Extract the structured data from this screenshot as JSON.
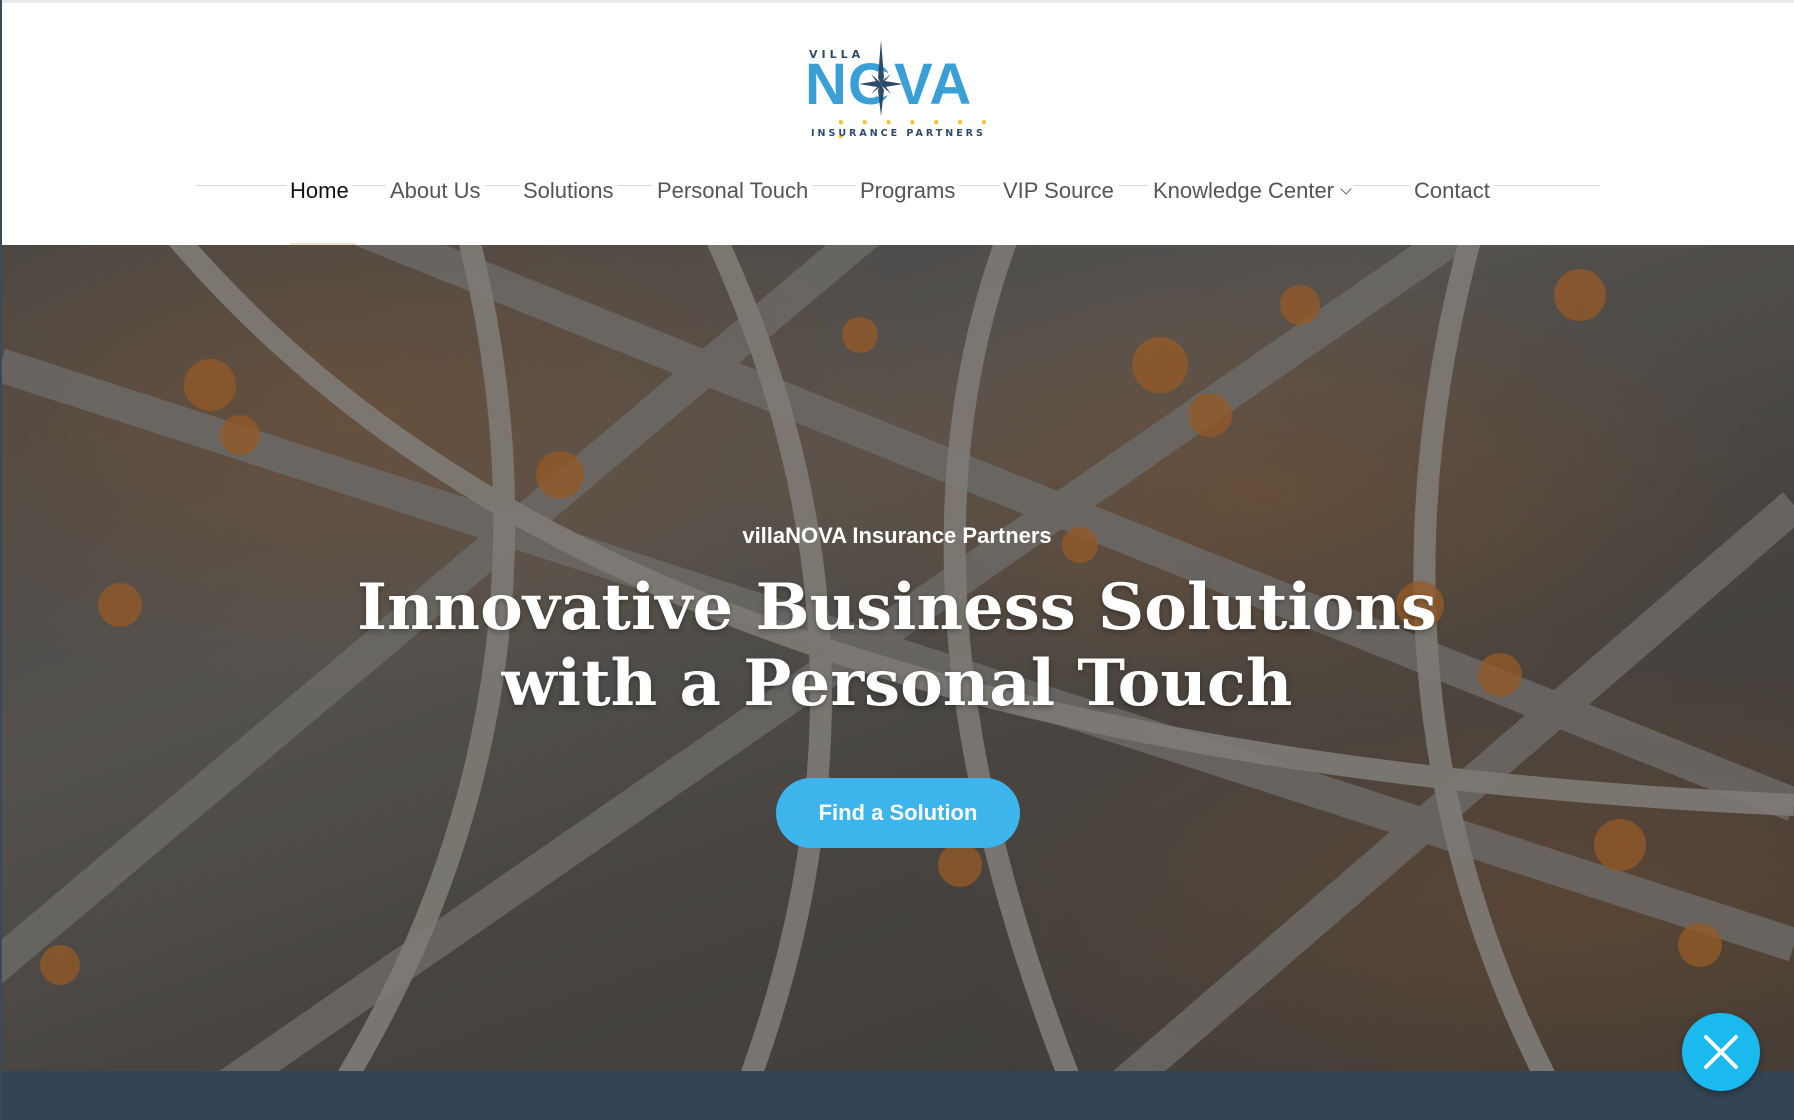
{
  "brand": {
    "logo_top": "VILLA",
    "logo_main": "NOVA",
    "logo_sub": "INSURANCE PARTNERS",
    "logo_dots": "• • • • • • • •",
    "primary_color": "#3a9fd6",
    "accent_color": "#f2c433"
  },
  "nav": {
    "items": [
      {
        "label": "Home",
        "active": true
      },
      {
        "label": "About Us"
      },
      {
        "label": "Solutions"
      },
      {
        "label": "Personal Touch"
      },
      {
        "label": "Programs"
      },
      {
        "label": "VIP Source"
      },
      {
        "label": "Knowledge Center",
        "has_dropdown": true
      },
      {
        "label": "Contact"
      }
    ]
  },
  "hero": {
    "eyebrow": "villaNOVA Insurance Partners",
    "title": "Innovative Business Solutions with a Personal Touch",
    "button_label": "Find a Solution",
    "button_color": "#3db4ec"
  },
  "widgets": {
    "close_icon": "close-icon",
    "close_color": "#1ab9ef"
  }
}
